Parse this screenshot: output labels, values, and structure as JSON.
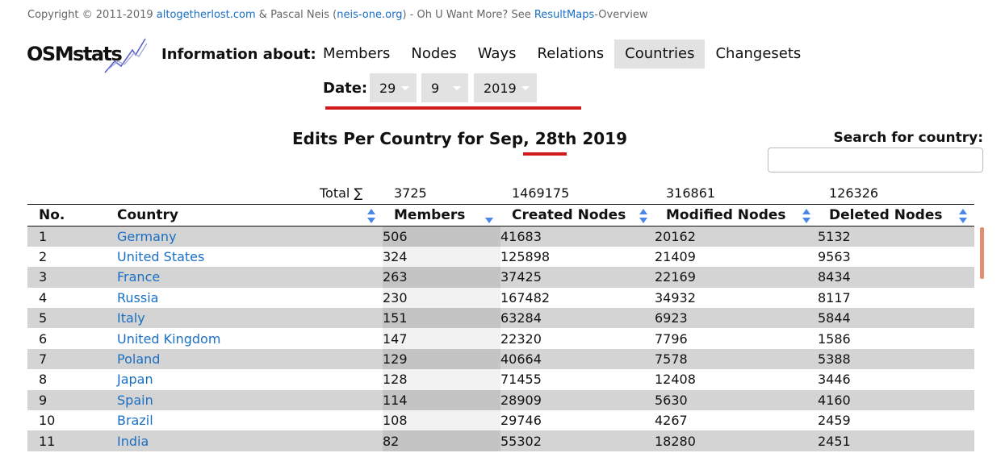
{
  "copyright": {
    "prefix": "Copyright © 2011-2019 ",
    "link1": "altogetherlost.com",
    "mid1": " & Pascal Neis (",
    "link2": "neis-one.org",
    "mid2": ") - Oh U Want More? See ",
    "link3": "ResultMaps",
    "suffix": "-Overview"
  },
  "logo": {
    "text": "OSMstats"
  },
  "header": {
    "info_label": "Information about:",
    "nav": [
      {
        "label": "Members",
        "active": false
      },
      {
        "label": "Nodes",
        "active": false
      },
      {
        "label": "Ways",
        "active": false
      },
      {
        "label": "Relations",
        "active": false
      },
      {
        "label": "Countries",
        "active": true
      },
      {
        "label": "Changesets",
        "active": false
      }
    ]
  },
  "date": {
    "label": "Date:",
    "day": "29",
    "month": "9",
    "year": "2019"
  },
  "page_title": "Edits Per Country for Sep, 28th 2019",
  "search": {
    "label": "Search for country:",
    "value": ""
  },
  "totals": {
    "label": "Total ∑",
    "members": "3725",
    "created": "1469175",
    "modified": "316861",
    "deleted": "126326"
  },
  "table": {
    "headers": [
      "No.",
      "Country",
      "Members",
      "Created Nodes",
      "Modified Nodes",
      "Deleted Nodes"
    ],
    "rows": [
      [
        "1",
        "Germany",
        "506",
        "41683",
        "20162",
        "5132"
      ],
      [
        "2",
        "United States",
        "324",
        "125898",
        "21409",
        "9563"
      ],
      [
        "3",
        "France",
        "263",
        "37425",
        "22169",
        "8434"
      ],
      [
        "4",
        "Russia",
        "230",
        "167482",
        "34932",
        "8117"
      ],
      [
        "5",
        "Italy",
        "151",
        "63284",
        "6923",
        "5844"
      ],
      [
        "6",
        "United Kingdom",
        "147",
        "22320",
        "7796",
        "1586"
      ],
      [
        "7",
        "Poland",
        "129",
        "40664",
        "7578",
        "5388"
      ],
      [
        "8",
        "Japan",
        "128",
        "71455",
        "12408",
        "3446"
      ],
      [
        "9",
        "Spain",
        "114",
        "28909",
        "5630",
        "4160"
      ],
      [
        "10",
        "Brazil",
        "108",
        "29746",
        "4267",
        "2459"
      ],
      [
        "11",
        "India",
        "82",
        "55302",
        "18280",
        "2451"
      ]
    ]
  },
  "colors": {
    "link": "#1a6fc4",
    "accent_red": "#d01a1a",
    "sort_arrow": "#4a86e8"
  }
}
